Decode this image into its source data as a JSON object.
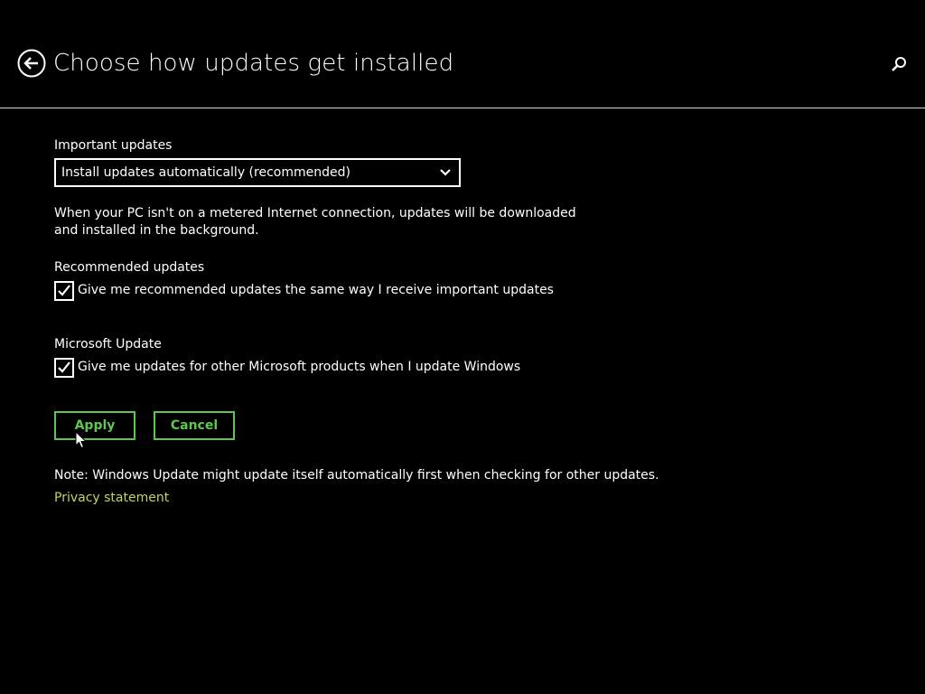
{
  "header": {
    "title": "Choose how updates get installed",
    "back_icon": "back-arrow-circle-icon",
    "search_icon": "search-icon"
  },
  "important_updates": {
    "label": "Important updates",
    "selected_option": "Install updates automatically (recommended)",
    "description": "When your PC isn't on a metered Internet connection, updates will be downloaded and installed in the background."
  },
  "recommended_updates": {
    "label": "Recommended updates",
    "checkbox_label": "Give me recommended updates the same way I receive important updates",
    "checked": true
  },
  "microsoft_update": {
    "label": "Microsoft Update",
    "checkbox_label": "Give me updates for other Microsoft products when I update Windows",
    "checked": true
  },
  "actions": {
    "apply_label": "Apply",
    "cancel_label": "Cancel"
  },
  "footer": {
    "note": "Note: Windows Update might update itself automatically first when checking for other updates.",
    "privacy_link": "Privacy statement"
  },
  "colors": {
    "background": "#000000",
    "text": "#ffffff",
    "button_accent": "#5ec751",
    "link": "#c3d65a",
    "divider": "#d9d9d9"
  }
}
